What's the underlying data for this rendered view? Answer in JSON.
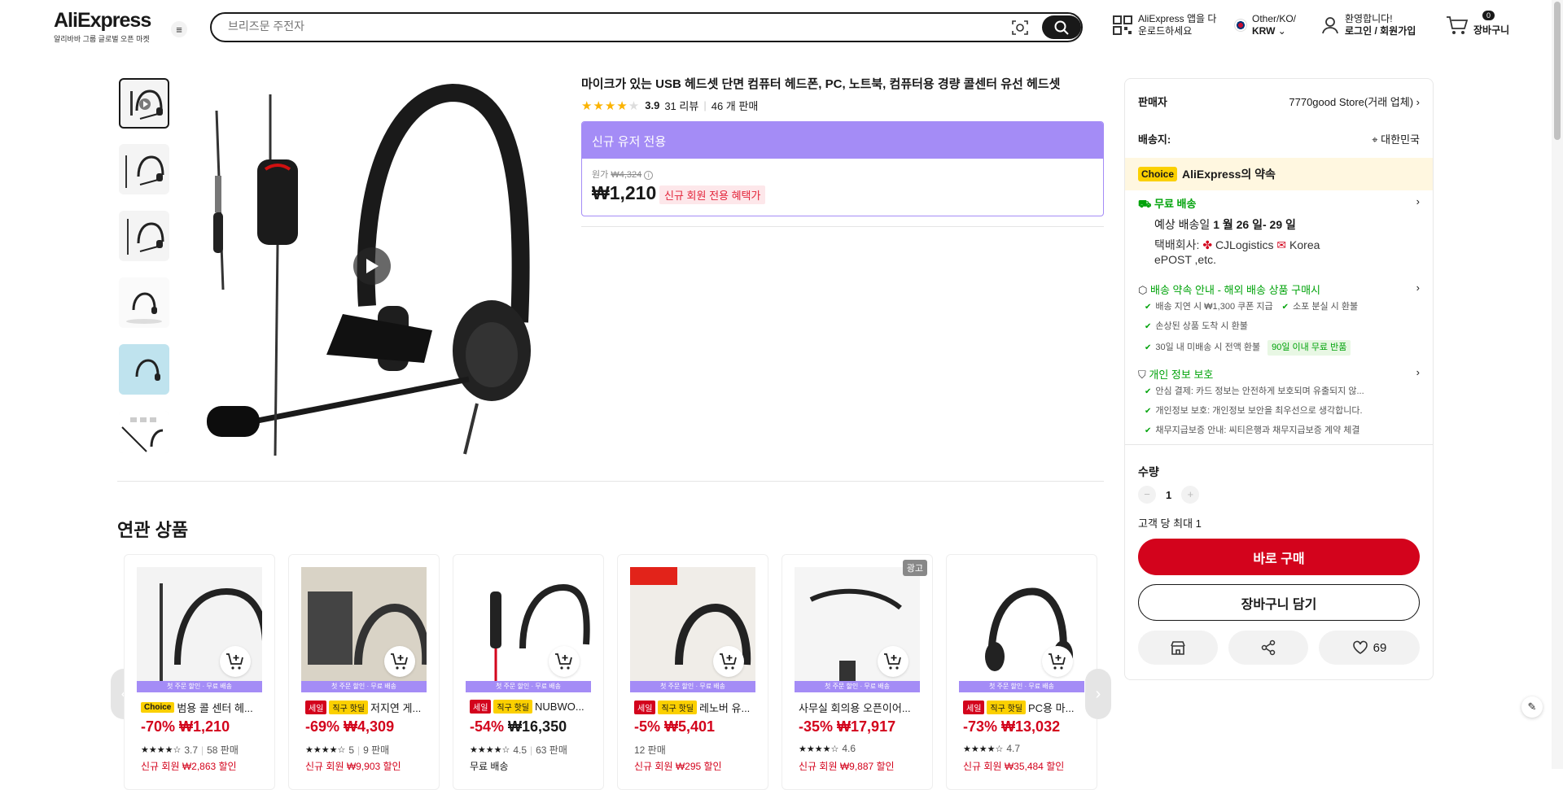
{
  "header": {
    "logo": "AliExpress",
    "logo_sub": "알리바바 그룹 글로벌 오픈 마켓",
    "search_placeholder": "브리즈문 주전자",
    "app_text_1": "AliExpress 앱을 다",
    "app_text_2": "운로드하세요",
    "region_1": "Other/KO/",
    "region_2": "KRW",
    "welcome": "환영합니다!",
    "login": "로그인 / 회원가입",
    "cart_count": "0",
    "cart_label": "장바구니"
  },
  "product": {
    "title": "마이크가 있는 USB 헤드셋 단면 컴퓨터 헤드폰, PC, 노트북, 컴퓨터용 경량 콜센터 유선 헤드셋",
    "rating": "3.9",
    "reviews": "31 리뷰",
    "sold": "46 개 판매",
    "stars_filled": 4,
    "promo_header": "신규 유저 전용",
    "orig_label": "원가",
    "orig_price": "₩4,324",
    "price": "₩1,210",
    "promo_badge": "신규 회원 전용 혜택가"
  },
  "seller": {
    "label": "판매자",
    "name": "7770good Store(거래 업체)",
    "ship_to_label": "배송지:",
    "ship_to": "대한민국",
    "choice_tag": "Choice",
    "choice_text": "AliExpress의 약속",
    "free_ship": "무료 배송",
    "est_label": "예상 배송일",
    "est_date": "1 월 26 일- 29 일",
    "carrier_label": "택배회사:",
    "carrier_1": "CJLogistics",
    "carrier_2": "Korea",
    "carrier_3": "ePOST ,etc.",
    "guarantee_title": "배송 약속 안내 - 해외 배송 상품 구매시",
    "g1": "배송 지연 시 ₩1,300 쿠폰 지급",
    "g2": "소포 분실 시 환불",
    "g3": "손상된 상품 도착 시 환불",
    "g4": "30일 내 미배송 시 전액 환불",
    "g4_tag": "90일 이내 무료 반품",
    "privacy_title": "개인 정보 보호",
    "p1": "안심 결제: 카드 정보는 안전하게 보호되며 유출되지 않...",
    "p2": "개인정보 보호: 개인정보 보안을 최우선으로 생각합니다.",
    "p3": "채무지급보증 안내: 씨티은행과 채무지급보증 계약 체결",
    "qty_label": "수량",
    "qty": "1",
    "qty_limit": "고객 당 최대 1",
    "buy_now": "바로 구매",
    "add_cart": "장바구니 담기",
    "wish_count": "69"
  },
  "related": {
    "title": "연관 상품",
    "band": "첫 주문 할인 · 무료 배송",
    "ad_label": "광고",
    "items": [
      {
        "tag1": "Choice",
        "tag2": "",
        "name": "범용 콜 센터 헤...",
        "discount": "-70%",
        "price": "₩1,210",
        "rating": "3.7",
        "sold": "58 판매",
        "coupon": "신규 회원 ₩2,863 할인"
      },
      {
        "tag1": "세일",
        "tag2": "직구 핫딜",
        "name": "저지연 게...",
        "discount": "-69%",
        "price": "₩4,309",
        "rating": "5",
        "sold": "9 판매",
        "coupon": "신규 회원 ₩9,903 할인"
      },
      {
        "tag1": "세일",
        "tag2": "직구 핫딜",
        "name": "NUBWO...",
        "discount": "-54%",
        "price": "₩16,350",
        "rating": "4.5",
        "sold": "63 판매",
        "coupon": "무료 배송"
      },
      {
        "tag1": "세일",
        "tag2": "직구 핫딜",
        "name": "레노버 유...",
        "discount": "-5%",
        "price": "₩5,401",
        "rating": "",
        "sold": "12 판매",
        "coupon": "신규 회원 ₩295 할인"
      },
      {
        "tag1": "",
        "tag2": "",
        "name": "사무실 회의용 오픈이어...",
        "discount": "-35%",
        "price": "₩17,917",
        "rating": "4.6",
        "sold": "",
        "coupon": "신규 회원 ₩9,887 할인"
      },
      {
        "tag1": "세일",
        "tag2": "직구 핫딜",
        "name": "PC용 마...",
        "discount": "-73%",
        "price": "₩13,032",
        "rating": "4.7",
        "sold": "",
        "coupon": "신규 회원 ₩35,484 할인"
      }
    ]
  },
  "colors": {
    "accent": "#d3031c",
    "promo": "#a48cf6",
    "choice": "#fbd000",
    "green": "#00a30a"
  }
}
